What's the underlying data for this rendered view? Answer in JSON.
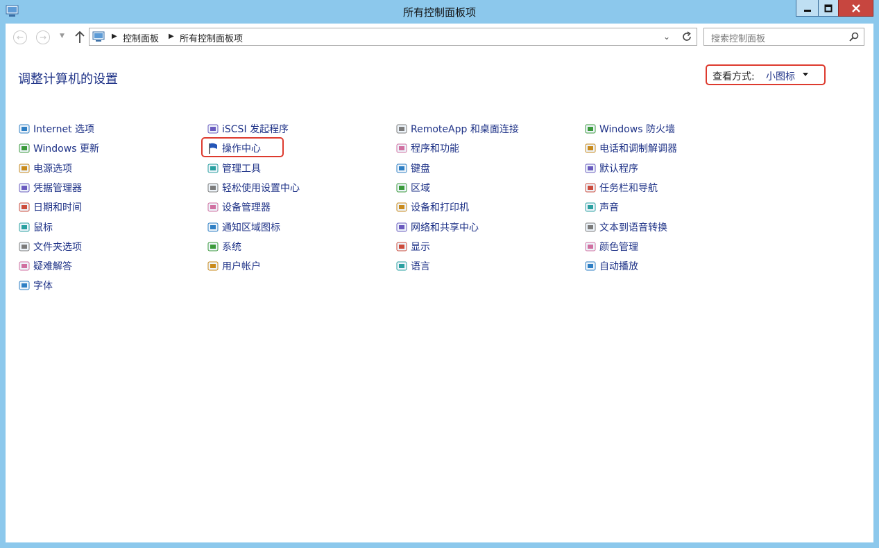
{
  "window": {
    "title": "所有控制面板项",
    "buttons": {
      "minimize": "minimize",
      "maximize": "maximize",
      "close": "close"
    }
  },
  "navbar": {
    "breadcrumbs": [
      "控制面板",
      "所有控制面板项"
    ],
    "search_placeholder": "搜索控制面板"
  },
  "heading": "调整计算机的设置",
  "view_by": {
    "label": "查看方式:",
    "value": "小图标"
  },
  "columns": [
    [
      {
        "label": "Internet 选项",
        "icon": "internet-options-icon"
      },
      {
        "label": "Windows 更新",
        "icon": "windows-update-icon"
      },
      {
        "label": "电源选项",
        "icon": "power-options-icon"
      },
      {
        "label": "凭据管理器",
        "icon": "credential-manager-icon"
      },
      {
        "label": "日期和时间",
        "icon": "date-time-icon"
      },
      {
        "label": "鼠标",
        "icon": "mouse-icon"
      },
      {
        "label": "文件夹选项",
        "icon": "folder-options-icon"
      },
      {
        "label": "疑难解答",
        "icon": "troubleshooting-icon"
      },
      {
        "label": "字体",
        "icon": "fonts-icon"
      }
    ],
    [
      {
        "label": "iSCSI 发起程序",
        "icon": "iscsi-initiator-icon"
      },
      {
        "label": "操作中心",
        "icon": "action-center-flag-icon"
      },
      {
        "label": "管理工具",
        "icon": "administrative-tools-icon"
      },
      {
        "label": "轻松使用设置中心",
        "icon": "ease-of-access-icon"
      },
      {
        "label": "设备管理器",
        "icon": "device-manager-icon"
      },
      {
        "label": "通知区域图标",
        "icon": "notification-area-icon"
      },
      {
        "label": "系统",
        "icon": "system-icon"
      },
      {
        "label": "用户帐户",
        "icon": "user-accounts-icon"
      }
    ],
    [
      {
        "label": "RemoteApp 和桌面连接",
        "icon": "remoteapp-icon"
      },
      {
        "label": "程序和功能",
        "icon": "programs-features-icon"
      },
      {
        "label": "键盘",
        "icon": "keyboard-icon"
      },
      {
        "label": "区域",
        "icon": "region-icon"
      },
      {
        "label": "设备和打印机",
        "icon": "devices-printers-icon"
      },
      {
        "label": "网络和共享中心",
        "icon": "network-sharing-icon"
      },
      {
        "label": "显示",
        "icon": "display-icon"
      },
      {
        "label": "语言",
        "icon": "language-icon"
      }
    ],
    [
      {
        "label": "Windows 防火墙",
        "icon": "firewall-icon"
      },
      {
        "label": "电话和调制解调器",
        "icon": "phone-modem-icon"
      },
      {
        "label": "默认程序",
        "icon": "default-programs-icon"
      },
      {
        "label": "任务栏和导航",
        "icon": "taskbar-navigation-icon"
      },
      {
        "label": "声音",
        "icon": "sound-icon"
      },
      {
        "label": "文本到语音转换",
        "icon": "text-to-speech-icon"
      },
      {
        "label": "颜色管理",
        "icon": "color-management-icon"
      },
      {
        "label": "自动播放",
        "icon": "autoplay-icon"
      }
    ]
  ],
  "colors": {
    "frame": "#8cc8ec",
    "link": "#1e3287",
    "highlight": "#dd3a2e",
    "close_button": "#c7463f"
  }
}
